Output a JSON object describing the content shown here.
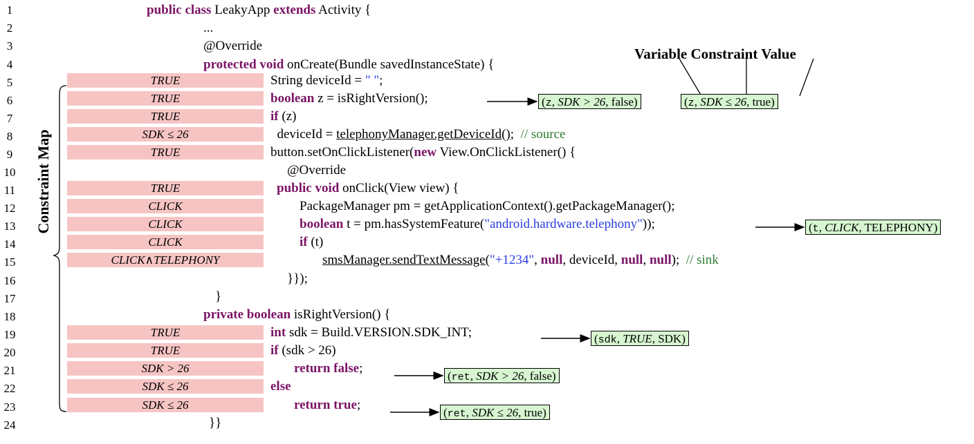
{
  "line_numbers": [
    "1",
    "2",
    "3",
    "4",
    "5",
    "6",
    "7",
    "8",
    "9",
    "10",
    "11",
    "12",
    "13",
    "14",
    "15",
    "16",
    "17",
    "18",
    "19",
    "20",
    "21",
    "22",
    "23",
    "24"
  ],
  "side_label": "Constraint Map",
  "header": {
    "variable": "Variable",
    "constraint": "Constraint",
    "value": "Value"
  },
  "constraints": [
    {
      "line": "5",
      "text": "TRUE"
    },
    {
      "line": "6",
      "text": "TRUE"
    },
    {
      "line": "7",
      "text": "TRUE"
    },
    {
      "line": "8",
      "text": "SDK ≤ 26"
    },
    {
      "line": "9",
      "text": "TRUE"
    },
    {
      "line": "11",
      "text": "TRUE"
    },
    {
      "line": "12",
      "text": "CLICK"
    },
    {
      "line": "13",
      "text": "CLICK"
    },
    {
      "line": "14",
      "text": "CLICK"
    },
    {
      "line": "15",
      "text": "CLICK∧TELEPHONY"
    },
    {
      "line": "19",
      "text": "TRUE"
    },
    {
      "line": "20",
      "text": "TRUE"
    },
    {
      "line": "21",
      "text": "SDK > 26"
    },
    {
      "line": "22",
      "text": "SDK ≤ 26"
    },
    {
      "line": "23",
      "text": "SDK ≤ 26"
    }
  ],
  "code": {
    "l1": {
      "kw1": "public class",
      "t1": " LeakyApp ",
      "kw2": "extends",
      "t2": " Activity {"
    },
    "l2": {
      "t1": "..."
    },
    "l3": {
      "t1": "@Override"
    },
    "l4": {
      "kw1": "protected void",
      "t1": " onCreate(Bundle savedInstanceState) {"
    },
    "l5": {
      "t1": "String deviceId = ",
      "str": "\" \"",
      "t2": ";"
    },
    "l6": {
      "kw1": "boolean",
      "t1": " z = isRightVersion();"
    },
    "l7": {
      "kw1": "if",
      "t1": " (z)"
    },
    "l8": {
      "t1": "  deviceId = ",
      "ul": "telephonyManager.getDeviceId()",
      "t2": ";  ",
      "cmt": "// source"
    },
    "l9": {
      "t1": "button.setOnClickListener(",
      "kw1": "new",
      "t2": " View.OnClickListener() {"
    },
    "l10": {
      "t1": "@Override"
    },
    "l11": {
      "kw1": "public void",
      "t1": " onClick(View view) {"
    },
    "l12": {
      "t1": "PackageManager pm = getApplicationContext().getPackageManager();"
    },
    "l13": {
      "kw1": "boolean",
      "t1": " t = pm.hasSystemFeature(",
      "str": "\"android.hardware.telephony\"",
      "t2": "));"
    },
    "l14": {
      "kw1": "if",
      "t1": " (t)"
    },
    "l15": {
      "ul": "smsManager.sendTextMessage(",
      "str": "\"+1234\"",
      "t1": ", ",
      "kw1": "null",
      "t2": ", deviceId, ",
      "kw2": "null",
      "t3": ", ",
      "kw3": "null",
      "t4": ");  ",
      "cmt": "// sink"
    },
    "l16": {
      "t1": "}});"
    },
    "l17": {
      "t1": "}"
    },
    "l18": {
      "kw1": "private boolean",
      "t1": " isRightVersion() {"
    },
    "l19": {
      "kw1": "int",
      "t1": " sdk = Build.VERSION.SDK_INT;"
    },
    "l20": {
      "kw1": "if",
      "t1": " (sdk > 26)"
    },
    "l21": {
      "kw1": "return false",
      "t1": ";"
    },
    "l22": {
      "kw1": "else"
    },
    "l23": {
      "kw1": "return true",
      "t1": ";"
    },
    "l24": {
      "t1": "}}"
    }
  },
  "tuples": {
    "z_false": {
      "var": "z",
      "sep1": ", ",
      "con": "SDK > 26",
      "sep2": ", ",
      "val": "false",
      "open": "(",
      "close": ")"
    },
    "z_true": {
      "var": "z",
      "sep1": ", ",
      "con": "SDK ≤ 26",
      "sep2": ", ",
      "val": "true",
      "open": "(",
      "close": ")"
    },
    "t_click": {
      "var": "t",
      "sep1": ", ",
      "con": "CLICK",
      "sep2": ", ",
      "val": "TELEPHONY",
      "open": "(",
      "close": ")"
    },
    "sdk_true": {
      "var": "sdk",
      "sep1": ", ",
      "con": "TRUE",
      "sep2": ", ",
      "val": "SDK",
      "open": "(",
      "close": ")"
    },
    "ret_false": {
      "var": "ret",
      "sep1": ", ",
      "con": "SDK > 26",
      "sep2": ", ",
      "val": "false",
      "open": "(",
      "close": ")"
    },
    "ret_true": {
      "var": "ret",
      "sep1": ", ",
      "con": "SDK ≤ 26",
      "sep2": ", ",
      "val": "true",
      "open": "(",
      "close": ")"
    }
  },
  "colors": {
    "constraint_box": "#f7c4c4",
    "tuple_box": "#d6f5d0",
    "keyword": "#7b1466",
    "string": "#2a3de0",
    "comment": "#2e7d32"
  }
}
